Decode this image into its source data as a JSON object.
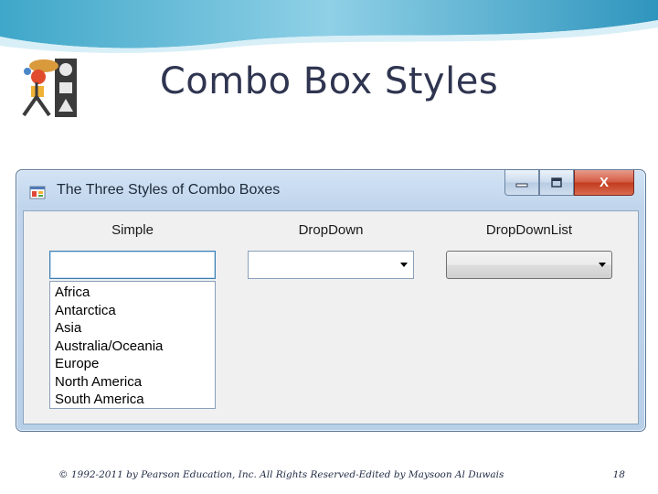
{
  "slide": {
    "title": "Combo Box Styles",
    "footer": "© 1992-2011 by Pearson Education, Inc. All Rights Reserved-Edited by Maysoon Al Duwais",
    "page_number": "18"
  },
  "window": {
    "title": "The Three Styles of Combo Boxes",
    "buttons": {
      "minimize_icon": "minimize-icon",
      "maximize_icon": "maximize-icon",
      "close_label": "X"
    }
  },
  "combos": {
    "simple": {
      "label": "Simple",
      "value": "",
      "items": [
        "Africa",
        "Antarctica",
        "Asia",
        "Australia/Oceania",
        "Europe",
        "North America",
        "South America"
      ]
    },
    "dropdown": {
      "label": "DropDown",
      "value": ""
    },
    "dropdownlist": {
      "label": "DropDownList",
      "value": ""
    }
  },
  "colors": {
    "title_text": "#2f3550",
    "window_frame": "#b8cfe8",
    "close_button": "#c23a1d"
  }
}
